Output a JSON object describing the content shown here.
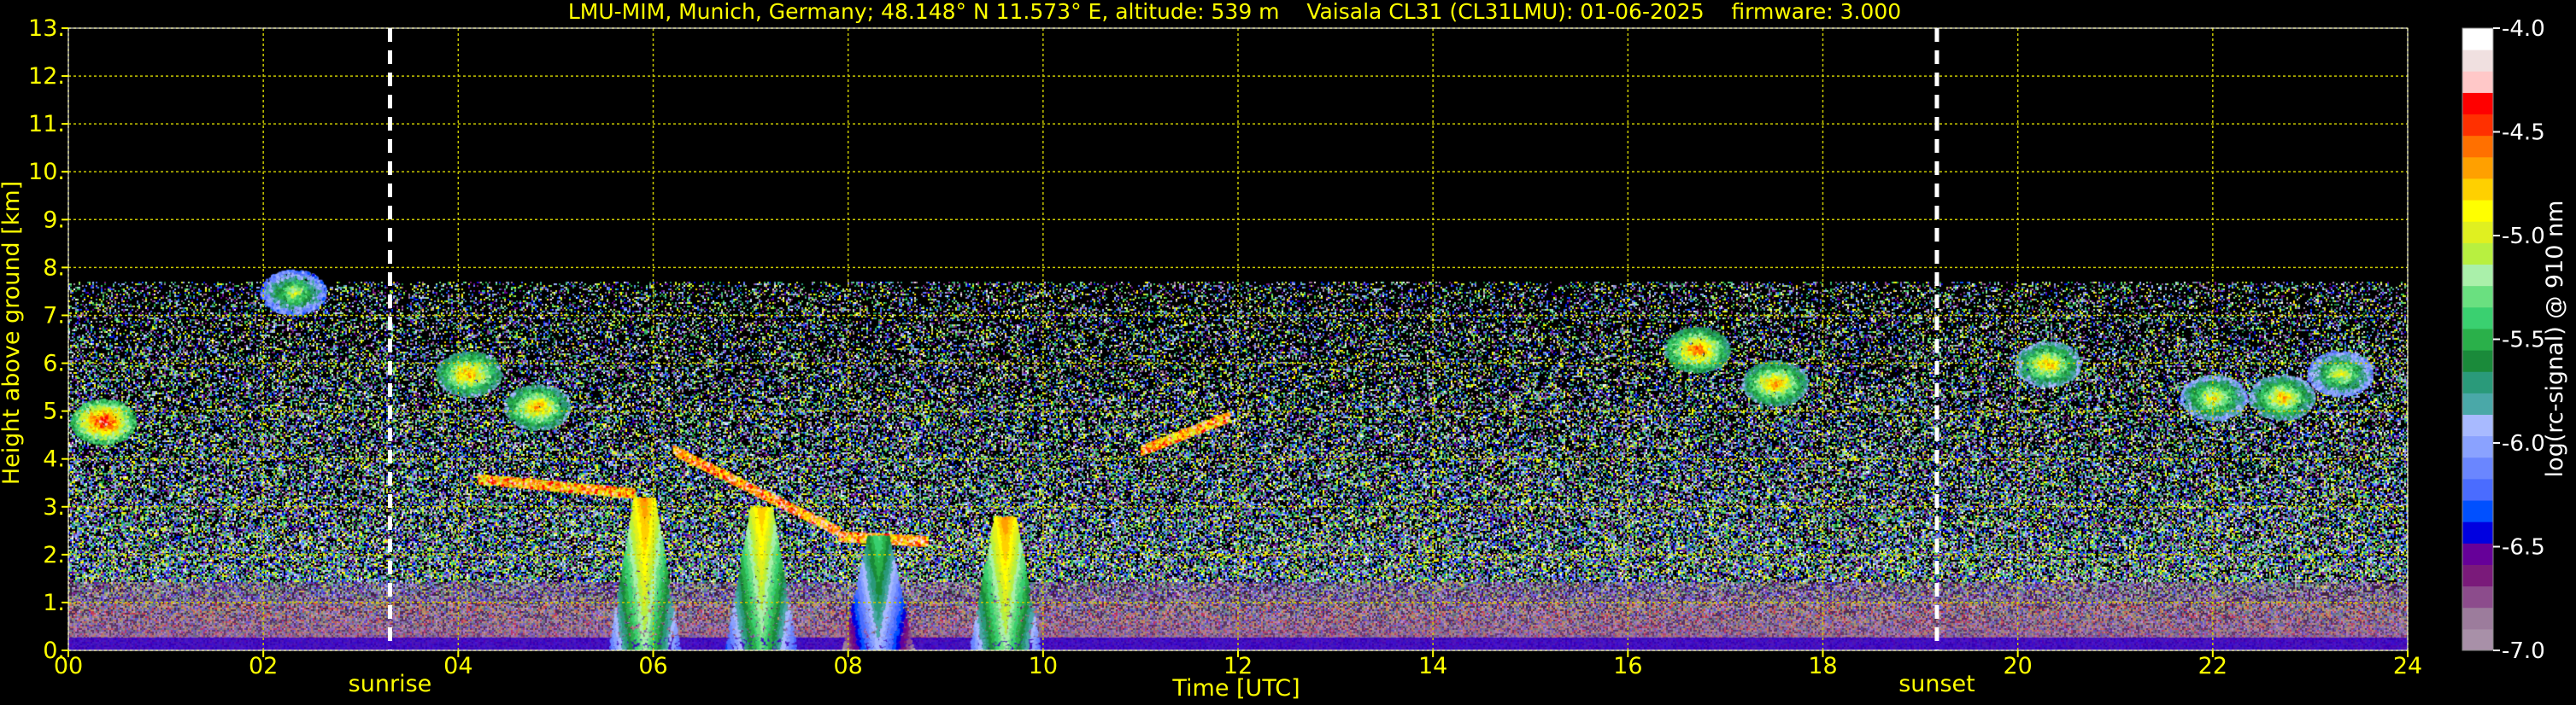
{
  "chart_data": {
    "type": "heatmap",
    "title": "LMU-MIM, Munich, Germany; 48.148° N 11.573° E, altitude: 539 m    Vaisala CL31 (CL31LMU): 01-06-2025    firmware: 3.000",
    "xlabel": "Time [UTC]",
    "ylabel": "Height above ground [km]",
    "xlim": [
      0,
      24
    ],
    "ylim": [
      0,
      13
    ],
    "x_ticks": [
      {
        "value": 0,
        "label": "00"
      },
      {
        "value": 2,
        "label": "02"
      },
      {
        "value": 4,
        "label": "04"
      },
      {
        "value": 6,
        "label": "06"
      },
      {
        "value": 8,
        "label": "08"
      },
      {
        "value": 10,
        "label": "10"
      },
      {
        "value": 12,
        "label": "12"
      },
      {
        "value": 14,
        "label": "14"
      },
      {
        "value": 16,
        "label": "16"
      },
      {
        "value": 18,
        "label": "18"
      },
      {
        "value": 20,
        "label": "20"
      },
      {
        "value": 22,
        "label": "22"
      },
      {
        "value": 24,
        "label": "24"
      }
    ],
    "y_ticks": [
      {
        "value": 0,
        "label": "0."
      },
      {
        "value": 1,
        "label": "1."
      },
      {
        "value": 2,
        "label": "2."
      },
      {
        "value": 3,
        "label": "3."
      },
      {
        "value": 4,
        "label": "4."
      },
      {
        "value": 5,
        "label": "5."
      },
      {
        "value": 6,
        "label": "6."
      },
      {
        "value": 7,
        "label": "7."
      },
      {
        "value": 8,
        "label": "8."
      },
      {
        "value": 9,
        "label": "9."
      },
      {
        "value": 10,
        "label": "10."
      },
      {
        "value": 11,
        "label": "11."
      },
      {
        "value": 12,
        "label": "12."
      },
      {
        "value": 13,
        "label": "13."
      }
    ],
    "grid": true,
    "grid_color": "#c8c800",
    "markers": [
      {
        "label": "sunrise",
        "time": 3.3
      },
      {
        "label": "sunset",
        "time": 19.17
      }
    ],
    "max_range_km": 7.7,
    "colorbar": {
      "label": "log(rc-signal) @ 910 nm",
      "range": [
        -7.0,
        -4.0
      ],
      "ticks": [
        {
          "value": -4.0,
          "label": "-4.0"
        },
        {
          "value": -4.5,
          "label": "-4.5"
        },
        {
          "value": -5.0,
          "label": "-5.0"
        },
        {
          "value": -5.5,
          "label": "-5.5"
        },
        {
          "value": -6.0,
          "label": "-6.0"
        },
        {
          "value": -6.5,
          "label": "-6.5"
        },
        {
          "value": -7.0,
          "label": "-7.0"
        }
      ],
      "colors_low_to_high": [
        "#a890a8",
        "#9c7c9c",
        "#8c4c8c",
        "#7a1a7a",
        "#660099",
        "#0000e0",
        "#0050ff",
        "#4a6cff",
        "#6a86ff",
        "#8aa2ff",
        "#a8baff",
        "#4aa8a8",
        "#2a9a7a",
        "#1a8a3a",
        "#2ab04a",
        "#3ad070",
        "#6ae080",
        "#aaf0aa",
        "#b8f040",
        "#e0f020",
        "#ffff00",
        "#ffd000",
        "#ffa000",
        "#ff7000",
        "#ff3000",
        "#ff0000",
        "#ffc8c8",
        "#f0e0e0",
        "#ffffff"
      ]
    },
    "features": [
      {
        "name": "cloud",
        "t": 0.35,
        "h": 4.8,
        "level": -4.3
      },
      {
        "name": "cloud",
        "t": 2.3,
        "h": 7.5,
        "level": -5.0
      },
      {
        "name": "cloud",
        "t": 4.1,
        "h": 5.8,
        "level": -4.6
      },
      {
        "name": "cloud",
        "t": 4.8,
        "h": 5.1,
        "level": -4.6
      },
      {
        "name": "layer",
        "t0": 4.2,
        "t1": 5.8,
        "h0": 3.6,
        "h1": 3.3,
        "level": -4.2
      },
      {
        "name": "layer",
        "t0": 6.2,
        "t1": 7.9,
        "h0": 4.2,
        "h1": 2.5,
        "level": -4.1
      },
      {
        "name": "layer",
        "t0": 7.9,
        "t1": 8.8,
        "h0": 2.4,
        "h1": 2.3,
        "level": -4.1
      },
      {
        "name": "layer",
        "t0": 11.0,
        "t1": 11.9,
        "h0": 4.2,
        "h1": 4.9,
        "level": -4.2
      },
      {
        "name": "precip_column",
        "t": 5.9,
        "h_top": 3.2,
        "level": -4.6
      },
      {
        "name": "precip_column",
        "t": 7.1,
        "h_top": 3.0,
        "level": -4.7
      },
      {
        "name": "precip_column",
        "t": 8.3,
        "h_top": 2.4,
        "level": -5.3
      },
      {
        "name": "precip_column",
        "t": 9.6,
        "h_top": 2.8,
        "level": -4.6
      },
      {
        "name": "cloud",
        "t": 20.3,
        "h": 6.0,
        "level": -4.7
      },
      {
        "name": "cloud",
        "t": 22.0,
        "h": 5.3,
        "level": -4.8
      },
      {
        "name": "cloud",
        "t": 22.7,
        "h": 5.3,
        "level": -4.7
      },
      {
        "name": "cloud",
        "t": 23.3,
        "h": 5.8,
        "level": -4.9
      },
      {
        "name": "cloud",
        "t": 17.5,
        "h": 5.6,
        "level": -4.6
      },
      {
        "name": "cloud",
        "t": 16.7,
        "h": 6.3,
        "level": -4.5
      }
    ]
  }
}
